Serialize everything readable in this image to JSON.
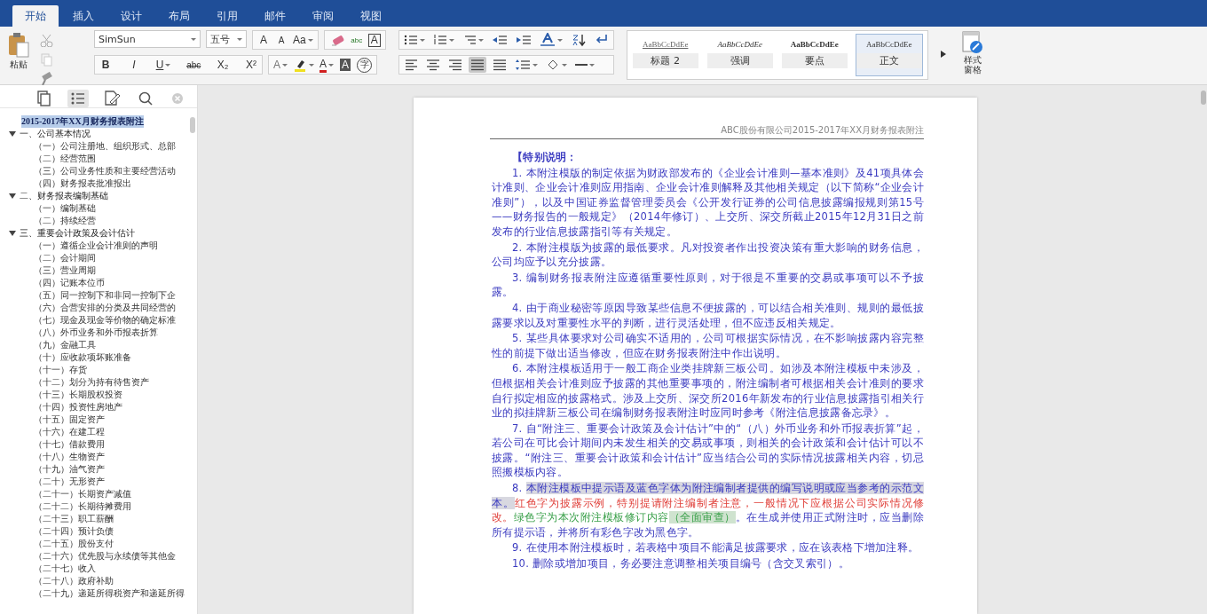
{
  "ribbon_tabs": [
    {
      "label": "开始",
      "selected": true
    },
    {
      "label": "插入",
      "selected": false
    },
    {
      "label": "设计",
      "selected": false
    },
    {
      "label": "布局",
      "selected": false
    },
    {
      "label": "引用",
      "selected": false
    },
    {
      "label": "邮件",
      "selected": false
    },
    {
      "label": "审阅",
      "selected": false
    },
    {
      "label": "视图",
      "selected": false
    }
  ],
  "clipboard": {
    "paste_label": "粘贴"
  },
  "font": {
    "family": "SimSun",
    "size": "五号"
  },
  "font_row1": [
    {
      "label": "A",
      "kind": "grow"
    },
    {
      "label": "A",
      "kind": "shrink"
    },
    {
      "label": "Aa",
      "kind": "case"
    }
  ],
  "font_row1_right": [
    {
      "label": "abc",
      "kind": "phonetic"
    },
    {
      "label": "A",
      "kind": "boxed"
    }
  ],
  "font_row2": [
    {
      "label": "B",
      "kind": "bold"
    },
    {
      "label": "I",
      "kind": "italic"
    },
    {
      "label": "U",
      "kind": "underline"
    },
    {
      "label": "abc",
      "kind": "strike"
    },
    {
      "label": "X₂",
      "kind": "sub"
    },
    {
      "label": "X²",
      "kind": "sup"
    }
  ],
  "font_row2_right": [
    {
      "label": "A",
      "kind": "effects"
    },
    {
      "label": "A",
      "kind": "color"
    },
    {
      "label": "A",
      "kind": "shaded"
    },
    {
      "label": "字",
      "kind": "circled"
    }
  ],
  "alignment": [
    {
      "kind": "left",
      "selected": false
    },
    {
      "kind": "center",
      "selected": false
    },
    {
      "kind": "right",
      "selected": false
    },
    {
      "kind": "justify",
      "selected": true
    },
    {
      "kind": "distributed",
      "selected": false
    }
  ],
  "styles": [
    {
      "preview": "AaBbCcDdEe",
      "name": "标题 2",
      "kind": "heading",
      "selected": false
    },
    {
      "preview": "AaBbCcDdEe",
      "name": "强调",
      "kind": "emphasis",
      "selected": false
    },
    {
      "preview": "AaBbCcDdEe",
      "name": "要点",
      "kind": "strong",
      "selected": false
    },
    {
      "preview": "AaBbCcDdEe",
      "name": "正文",
      "kind": "normal",
      "selected": true
    }
  ],
  "styles_pane_label": "样式窗格",
  "nav_tabs": [
    {
      "kind": "pages",
      "selected": false
    },
    {
      "kind": "headings",
      "selected": true
    },
    {
      "kind": "edit",
      "selected": false
    },
    {
      "kind": "search",
      "selected": false
    }
  ],
  "outline": {
    "title": "2015-2017年XX月财务报表附注",
    "selected": true,
    "children": [
      {
        "label": "一、公司基本情况",
        "expanded": true,
        "children": [
          {
            "label": "（一）公司注册地、组织形式、总部"
          },
          {
            "label": "（二）经营范围"
          },
          {
            "label": "（三）公司业务性质和主要经营活动"
          },
          {
            "label": "（四）财务报表批准报出"
          }
        ]
      },
      {
        "label": "二、财务报表编制基础",
        "expanded": true,
        "children": [
          {
            "label": "（一）编制基础"
          },
          {
            "label": "（二）持续经营"
          }
        ]
      },
      {
        "label": "三、重要会计政策及会计估计",
        "expanded": true,
        "children": [
          {
            "label": "（一）遵循企业会计准则的声明"
          },
          {
            "label": "（二）会计期间"
          },
          {
            "label": "（三）营业周期"
          },
          {
            "label": "（四）记账本位币"
          },
          {
            "label": "（五）同一控制下和非同一控制下企"
          },
          {
            "label": "（六）合营安排的分类及共同经营的"
          },
          {
            "label": "（七）现金及现金等价物的确定标准"
          },
          {
            "label": "（八）外币业务和外币报表折算"
          },
          {
            "label": "（九）金融工具"
          },
          {
            "label": "（十）应收款项坏账准备"
          },
          {
            "label": "（十一）存货"
          },
          {
            "label": "（十二）划分为持有待售资产"
          },
          {
            "label": "（十三）长期股权投资"
          },
          {
            "label": "（十四）投资性房地产"
          },
          {
            "label": "（十五）固定资产"
          },
          {
            "label": "（十六）在建工程"
          },
          {
            "label": "（十七）借款费用"
          },
          {
            "label": "（十八）生物资产"
          },
          {
            "label": "（十九）油气资产"
          },
          {
            "label": "（二十）无形资产"
          },
          {
            "label": "（二十一）长期资产减值"
          },
          {
            "label": "（二十二）长期待摊费用"
          },
          {
            "label": "（二十三）职工薪酬"
          },
          {
            "label": "（二十四）预计负债"
          },
          {
            "label": "（二十五）股份支付"
          },
          {
            "label": "（二十六）优先股与永续债等其他金"
          },
          {
            "label": "（二十七）收入"
          },
          {
            "label": "（二十八）政府补助"
          },
          {
            "label": "（二十九）递延所得税资产和递延所得"
          }
        ]
      }
    ]
  },
  "document": {
    "header": "ABC股份有限公司2015-2017年XX月财务报表附注",
    "paragraphs": [
      [
        {
          "text": "【特别说明：",
          "kind": "heading"
        }
      ],
      [
        {
          "text": "1. 本附注模版的制定依据为财政部发布的《企业会计准则—基本准则》及41项具体会计准则、企业会计准则应用指南、企业会计准则解释及其他相关规定（以下简称“企业会计准则”），以及中国证券监督管理委员会《公开发行证券的公司信息披露编报规则第15号——财务报告的一般规定》（2014年修订）、上交所、深交所截止2015年12月31日之前发布的行业信息披露指引等有关规定。",
          "kind": "blue"
        }
      ],
      [
        {
          "text": "2. 本附注模版为披露的最低要求。凡对投资者作出投资决策有重大影响的财务信息，公司均应予以充分披露。",
          "kind": "blue"
        }
      ],
      [
        {
          "text": "3. 编制财务报表附注应遵循重要性原则，对于很是不重要的交易或事项可以不予披露。",
          "kind": "blue"
        }
      ],
      [
        {
          "text": "4. 由于商业秘密等原因导致某些信息不便披露的，可以结合相关准则、规则的最低披露要求以及对重要性水平的判断，进行灵活处理，但不应违反相关规定。",
          "kind": "blue"
        }
      ],
      [
        {
          "text": "5. 某些具体要求对公司确实不适用的，公司可根据实际情况，在不影响披露内容完整性的前提下做出适当修改，但应在财务报表附注中作出说明。",
          "kind": "blue"
        }
      ],
      [
        {
          "text": "6. 本附注模板适用于一般工商企业类挂牌新三板公司。如涉及本附注模板中未涉及，但根据相关会计准则应予披露的其他重要事项的，附注编制者可根据相关会计准则的要求自行拟定相应的披露格式。涉及上交所、深交所2016年新发布的行业信息披露指引相关行业的拟挂牌新三板公司在编制财务报表附注时应同时参考《附注信息披露备忘录》。",
          "kind": "blue"
        }
      ],
      [
        {
          "text": "7. 自“附注三、重要会计政策及会计估计”中的“（八）外币业务和外币报表折算”起，若公司在可比会计期间内未发生相关的交易或事项，则相关的会计政策和会计估计可以不披露。“附注三、重要会计政策和会计估计”应当结合公司的实际情况披露相关内容，切忌照搬模板内容。",
          "kind": "blue"
        }
      ],
      [
        {
          "text": "8. ",
          "kind": "blue"
        },
        {
          "text": "本附注模板中提示语及蓝色字体为附注编制者提供的编写说明或应当参考的示范文本。",
          "kind": "blue-highlight"
        },
        {
          "text": "红色字为披露示例，特别提请附注编制者注意，一般情况下应根据公司实际情况修改。",
          "kind": "red"
        },
        {
          "text": "绿色字为本次附注模板修订内容",
          "kind": "green"
        },
        {
          "text": "（全面审查）",
          "kind": "green-highlight"
        },
        {
          "text": "。在生成并使用正式附注时，应当删除所有提示语，并将所有彩色字改为黑色字。",
          "kind": "blue"
        }
      ],
      [
        {
          "text": "9. 在使用本附注模板时，若表格中项目不能满足披露要求，应在该表格下增加注释。",
          "kind": "blue"
        }
      ],
      [
        {
          "text": "10. 删除或增加项目，务必要注意调整相关项目编号（含交叉索引）。",
          "kind": "blue"
        }
      ]
    ]
  }
}
